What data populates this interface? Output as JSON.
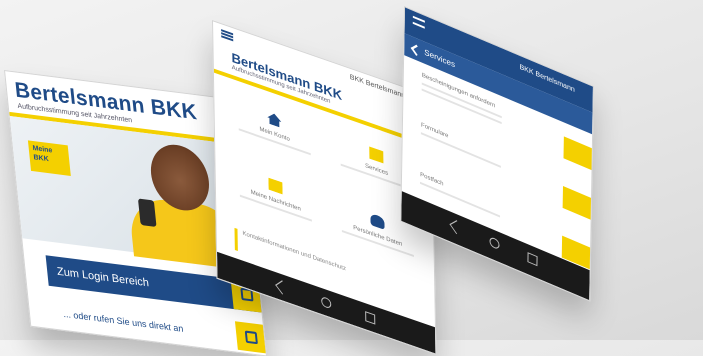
{
  "phone_left": {
    "brand": "Bertelsmann BKK",
    "brand_subtitle": "Aufbruchsstimmung seit Jahrzehnten",
    "badge": "Meine BKK",
    "cta_primary": "Zum Login Bereich",
    "cta_secondary": "... oder rufen Sie uns direkt an"
  },
  "phone_middle": {
    "top_title": "BKK Bertelsmann",
    "brand": "Bertelsmann BKK",
    "brand_subtitle": "Aufbruchsstimmung seit Jahrzehnten",
    "tiles": [
      "Mein Konto",
      "Services",
      "Meine Nachrichten",
      "Persönliche Daten"
    ],
    "note": "Kontaktinformationen und Datenschutz"
  },
  "phone_right": {
    "header_title": "BKK Bertelsmann",
    "subheader": "Services",
    "rows": [
      "Bescheinigungen anfordern",
      "Formulare",
      "Postfach"
    ]
  },
  "colors": {
    "brand_blue": "#1f4b87",
    "brand_yellow": "#f4d000",
    "nav_dark": "#1a1a1a"
  }
}
